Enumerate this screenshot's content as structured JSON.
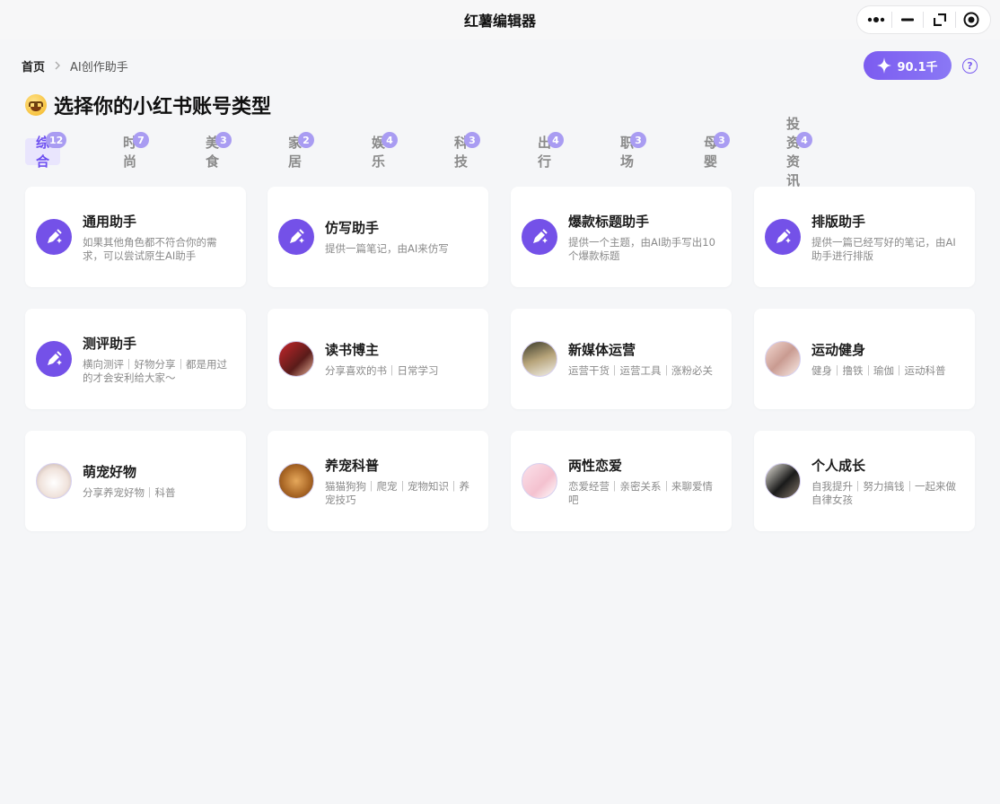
{
  "window": {
    "title": "红薯编辑器"
  },
  "breadcrumb": {
    "home": "首页",
    "current": "AI创作助手"
  },
  "credits": {
    "value": "90.1千",
    "accent": "#7b5ef0"
  },
  "help": {
    "glyph": "?"
  },
  "heading": {
    "text": "选择你的小红书账号类型",
    "emoji": "star-struck-face-icon"
  },
  "tabs": [
    {
      "label": "综合",
      "count": "12",
      "active": true
    },
    {
      "label": "时尚",
      "count": "7"
    },
    {
      "label": "美食",
      "count": "3"
    },
    {
      "label": "家居",
      "count": "2"
    },
    {
      "label": "娱乐",
      "count": "4"
    },
    {
      "label": "科技",
      "count": "3"
    },
    {
      "label": "出行",
      "count": "4"
    },
    {
      "label": "职场",
      "count": "3"
    },
    {
      "label": "母婴",
      "count": "3"
    },
    {
      "label": "投资资讯",
      "count": "4"
    }
  ],
  "cards": [
    {
      "name": "通用助手",
      "desc": "如果其他角色都不符合你的需求，可以尝试原生AI助手",
      "icon": "magic-pen-icon"
    },
    {
      "name": "仿写助手",
      "desc": "提供一篇笔记，由AI来仿写",
      "icon": "magic-pen-icon"
    },
    {
      "name": "爆款标题助手",
      "desc": "提供一个主题，由AI助手写出10个爆款标题",
      "icon": "magic-pen-icon"
    },
    {
      "name": "排版助手",
      "desc": "提供一篇已经写好的笔记，由AI助手进行排版",
      "icon": "magic-pen-icon"
    },
    {
      "name": "测评助手",
      "desc": "横向测评｜好物分享｜都是用过的才会安利给大家～",
      "icon": "magic-pen-icon"
    },
    {
      "name": "读书博主",
      "desc": "分享喜欢的书｜日常学习",
      "icon": "avatar-reader"
    },
    {
      "name": "新媒体运营",
      "desc": "运营干货｜运营工具｜涨粉必关",
      "icon": "avatar-woman"
    },
    {
      "name": "运动健身",
      "desc": "健身｜撸铁｜瑜伽｜运动科普",
      "icon": "avatar-fitness"
    },
    {
      "name": "萌宠好物",
      "desc": "分享养宠好物｜科普",
      "icon": "avatar-cat"
    },
    {
      "name": "养宠科普",
      "desc": "猫猫狗狗｜爬宠｜宠物知识｜养宠技巧",
      "icon": "avatar-dog"
    },
    {
      "name": "两性恋爱",
      "desc": "恋爱经营｜亲密关系｜来聊爱情吧",
      "icon": "avatar-love"
    },
    {
      "name": "个人成长",
      "desc": "自我提升｜努力搞钱｜一起来做自律女孩",
      "icon": "avatar-girl"
    }
  ]
}
